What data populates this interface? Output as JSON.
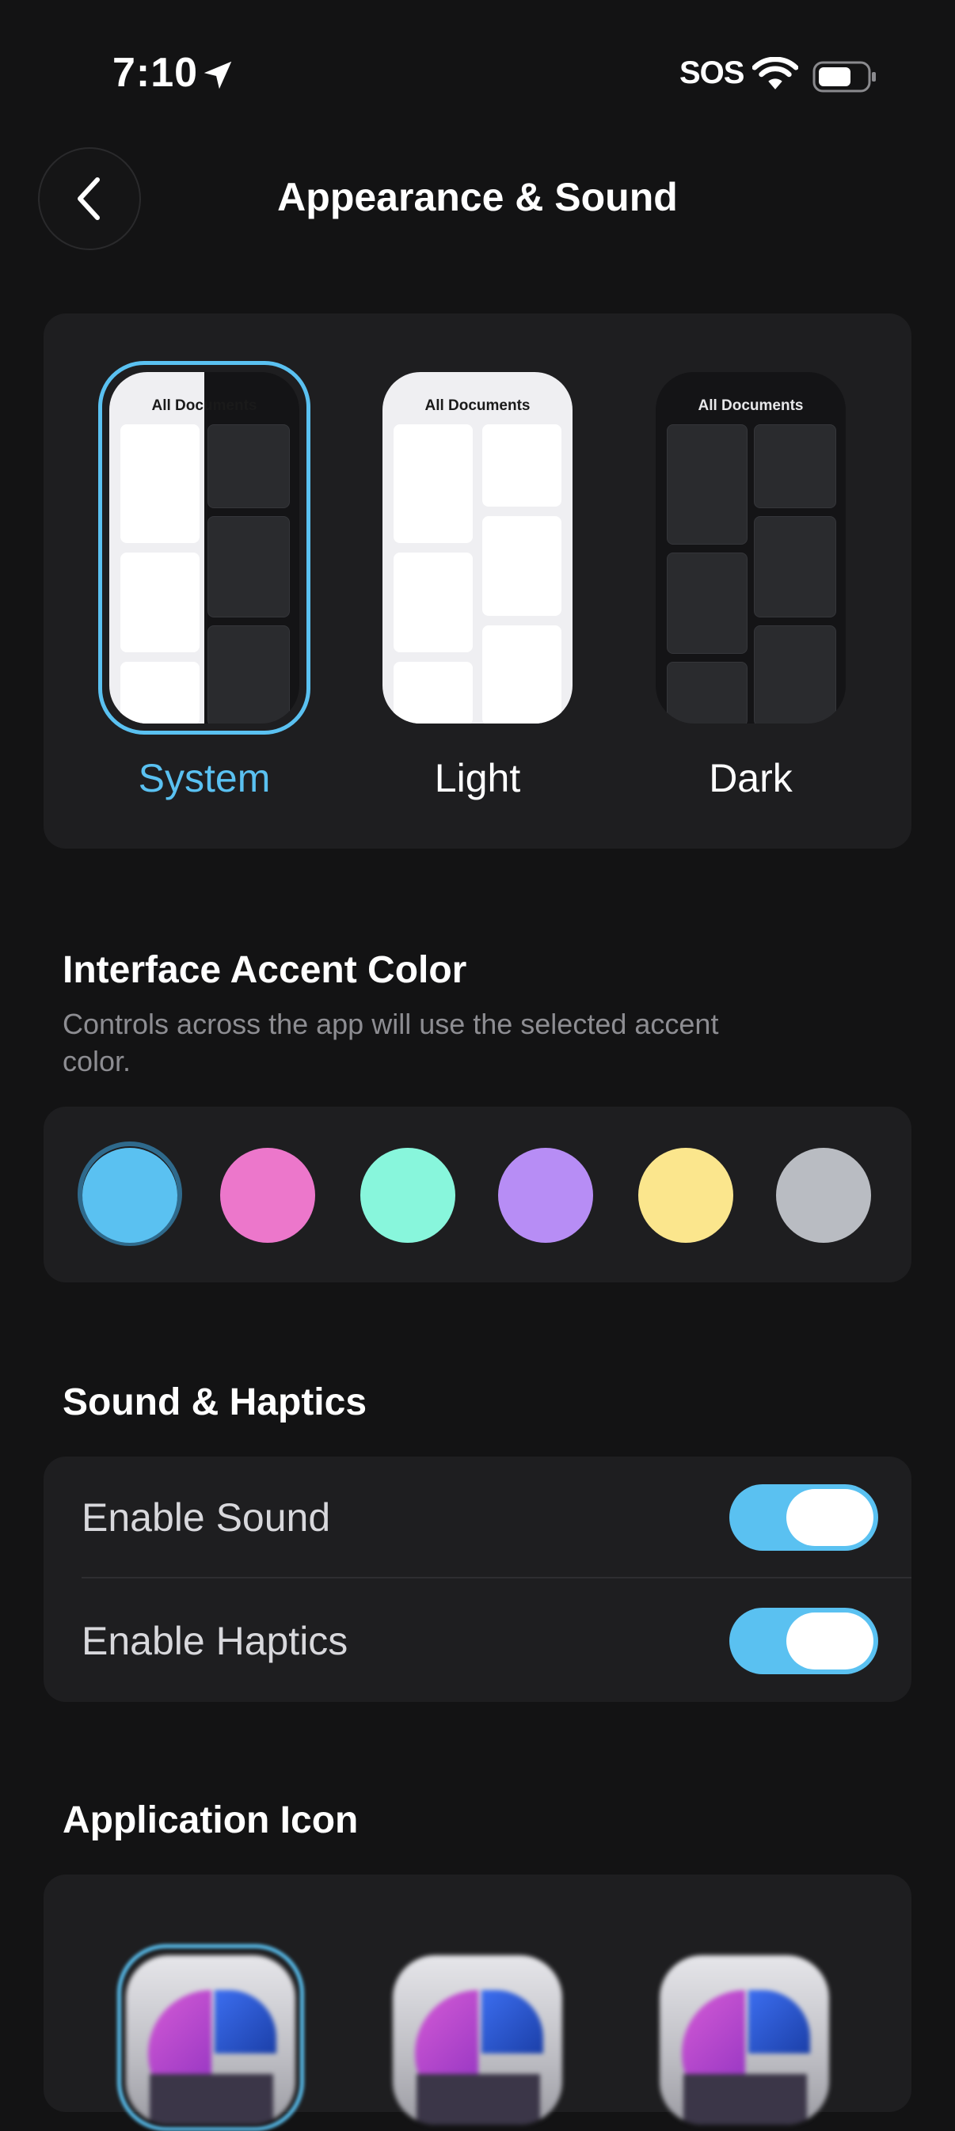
{
  "status_bar": {
    "time": "7:10",
    "carrier": "SOS",
    "icons": [
      "location-arrow-icon",
      "wifi-icon",
      "battery-icon"
    ]
  },
  "header": {
    "title": "Appearance & Sound",
    "back_icon": "chevron-left-icon"
  },
  "theme": {
    "preview_title": "All Documents",
    "options": [
      {
        "label": "System",
        "selected": true
      },
      {
        "label": "Light",
        "selected": false
      },
      {
        "label": "Dark",
        "selected": false
      }
    ]
  },
  "accent": {
    "heading": "Interface Accent Color",
    "description": "Controls across the app will use the selected accent color.",
    "colors": [
      "#5ac1f1",
      "#ec77cb",
      "#88f6dc",
      "#b78df5",
      "#fbe68d",
      "#b9bcc2"
    ],
    "selected_index": 0
  },
  "sound": {
    "heading": "Sound & Haptics",
    "rows": [
      {
        "label": "Enable Sound",
        "on": true
      },
      {
        "label": "Enable Haptics",
        "on": true
      }
    ]
  },
  "app_icon": {
    "heading": "Application Icon",
    "selected_index": 0
  }
}
